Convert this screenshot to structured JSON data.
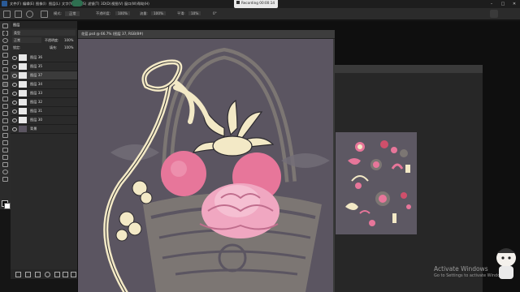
{
  "menubar": {
    "items": [
      "文件(F)",
      "编辑(E)",
      "图像(I)",
      "图层(L)",
      "文字(Y)",
      "选择(S)",
      "滤镜(T)",
      "3D(D)",
      "视图(V)",
      "窗口(W)",
      "帮助(H)"
    ],
    "window_controls": [
      "–",
      "□",
      "✕"
    ]
  },
  "recording": {
    "label": "Recording 00:00:14"
  },
  "options_bar": {
    "items": [
      "模式:",
      "正常",
      "不透明度:",
      "100%",
      "流量:",
      "100%",
      "平滑:",
      "10%",
      "0°"
    ]
  },
  "layers_panel": {
    "title": "图层",
    "kind": "类型",
    "blend_mode": "正常",
    "opacity_label": "不透明度:",
    "opacity_value": "100%",
    "lock_label": "锁定:",
    "fill_label": "填充:",
    "fill_value": "100%",
    "layers": [
      {
        "name": "图层 36",
        "selected": false
      },
      {
        "name": "图层 35",
        "selected": false
      },
      {
        "name": "图层 37",
        "selected": true
      },
      {
        "name": "图层 34",
        "selected": false
      },
      {
        "name": "图层 33",
        "selected": false
      },
      {
        "name": "图层 32",
        "selected": false
      },
      {
        "name": "图层 31",
        "selected": false
      },
      {
        "name": "图层 30",
        "selected": false
      },
      {
        "name": "背景",
        "selected": false
      }
    ]
  },
  "canvas_window": {
    "tab_label": "花篮.psd @ 66.7% (图层 37, RGB/8#)"
  },
  "watermark": {
    "line1": "Activate Windows",
    "line2": "Go to Settings to activate Windows."
  },
  "colors": {
    "canvas_bg": "#5b5561",
    "basket": "#7c7673",
    "ribbon": "#f3e9c6",
    "pink": "#e7769a",
    "rose": "#f0a7c1",
    "ui_dark": "#2b2b2b"
  }
}
